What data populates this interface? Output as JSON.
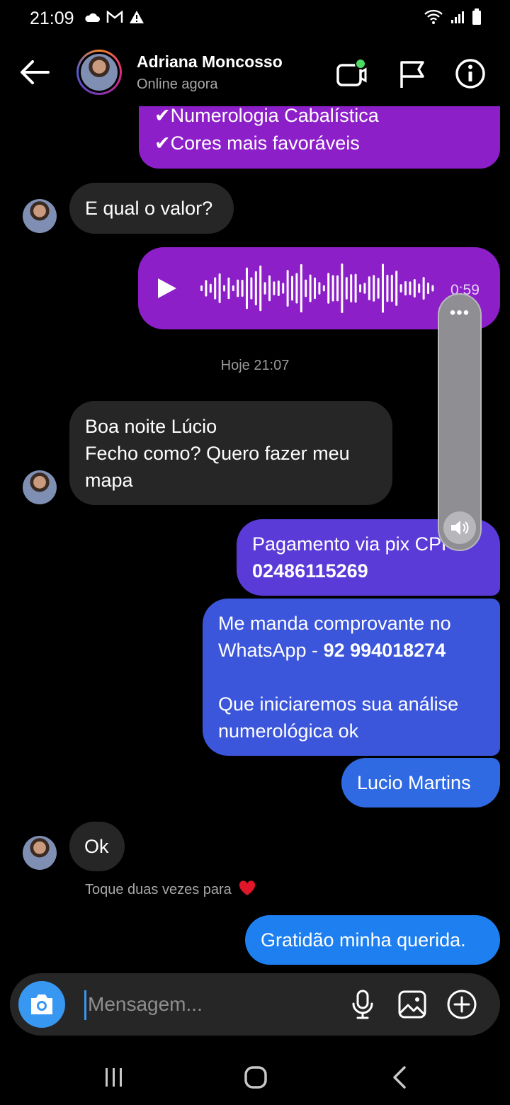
{
  "status_bar": {
    "time": "21:09",
    "left_icons": [
      "cloud-icon",
      "gmail-icon",
      "alert-icon"
    ],
    "right_icons": [
      "wifi-icon",
      "signal-icon",
      "battery-icon"
    ]
  },
  "header": {
    "contact_name": "Adriana Moncosso",
    "contact_status": "Online agora",
    "icons": [
      "back-arrow-icon",
      "video-call-icon",
      "flag-icon",
      "info-icon"
    ]
  },
  "messages": {
    "m1_line1": "✔Numerologia Cabalística",
    "m1_line2": "✔Cores mais favoráveis",
    "m2": "E qual o valor?",
    "audio_duration": "0:59",
    "timestamp": "Hoje 21:07",
    "m3_line1": "Boa noite Lúcio",
    "m3_line2": "Fecho como? Quero fazer meu",
    "m3_line3": "mapa",
    "m4_line1": "Pagamento via pix CPF",
    "m4_line2": "02486115269",
    "m5_line1": "Me manda comprovante no",
    "m5_line2a": "WhatsApp - ",
    "m5_line2b": "92 994018274",
    "m5_line3": "Que iniciaremos sua análise",
    "m5_line4": "numerológica ok",
    "m6": "Lucio Martins",
    "m7": "Ok",
    "hint": "Toque duas vezes para",
    "m8": "Gratidão minha querida."
  },
  "volume_overlay": {
    "dots": "•••"
  },
  "compose": {
    "placeholder": "Mensagem...",
    "icons": [
      "camera-icon",
      "microphone-icon",
      "gallery-icon",
      "plus-icon"
    ]
  },
  "nav_bar": {
    "icons": [
      "recents-icon",
      "home-icon",
      "back-icon"
    ]
  },
  "colors": {
    "purple_bubble": "#8d1fc9",
    "violet_bubble": "#5a3bd8",
    "blue_bubble": "#3b55db",
    "incoming_bubble": "#262626",
    "accent": "#3897f0"
  }
}
